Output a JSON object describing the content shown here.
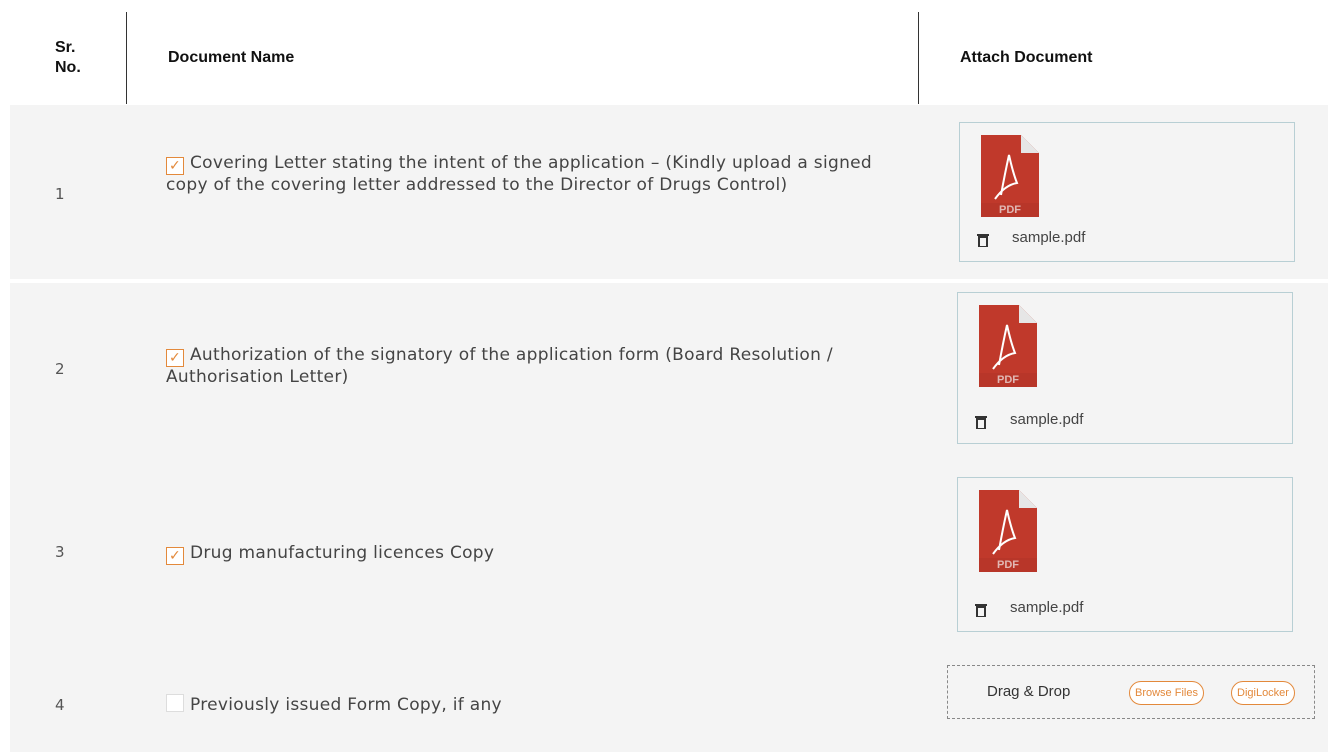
{
  "header": {
    "sr_no": "Sr.\nNo.",
    "sr_line1": "Sr.",
    "sr_line2": "No.",
    "document_name": "Document Name",
    "attach_document": "Attach Document"
  },
  "rows": [
    {
      "sr": "1",
      "checked": true,
      "name": "Covering Letter stating the intent of the application – (Kindly upload a signed copy of the covering letter addressed to the Director of Drugs Control)",
      "file": "sample.pdf"
    },
    {
      "sr": "2",
      "checked": true,
      "name": "Authorization of the signatory of the application form (Board Resolution / Authorisation Letter)",
      "file": "sample.pdf"
    },
    {
      "sr": "3",
      "checked": true,
      "name": "Drug manufacturing licences Copy",
      "file": "sample.pdf"
    },
    {
      "sr": "4",
      "checked": false,
      "name": "Previously issued Form Copy, if any",
      "file": ""
    }
  ],
  "dropzone": {
    "label": "Drag & Drop",
    "browse_label": "Browse Files",
    "digilocker_label": "DigiLocker"
  },
  "icons": {
    "check": "✓",
    "file": "pdf-file-icon",
    "delete": "trash-icon"
  },
  "colors": {
    "accent": "#e3893b",
    "row_bg": "#f4f4f4",
    "attach_border": "#b8cfd4",
    "pdf_red": "#c0392b"
  }
}
